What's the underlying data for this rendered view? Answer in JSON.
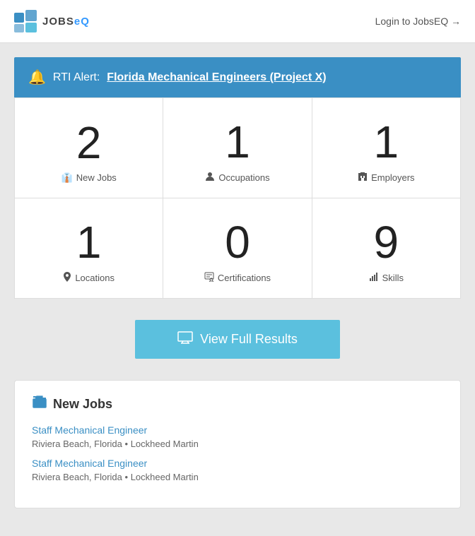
{
  "header": {
    "logo_text_jobs": "JOBS",
    "logo_text_eq": "eQ",
    "login_label": "Login to JobsEQ →"
  },
  "alert": {
    "text_prefix": "RTI Alert:",
    "link_text": "Florida Mechanical Engineers (Project X)"
  },
  "stats": [
    {
      "value": "2",
      "label": "New Jobs",
      "icon": "briefcase"
    },
    {
      "value": "1",
      "label": "Occupations",
      "icon": "person"
    },
    {
      "value": "1",
      "label": "Employers",
      "icon": "building"
    },
    {
      "value": "1",
      "label": "Locations",
      "icon": "pin"
    },
    {
      "value": "0",
      "label": "Certifications",
      "icon": "certificate"
    },
    {
      "value": "9",
      "label": "Skills",
      "icon": "skills"
    }
  ],
  "view_results_btn": "View Full Results",
  "new_jobs_section": {
    "title": "New Jobs",
    "jobs": [
      {
        "title": "Staff Mechanical Engineer",
        "location": "Riviera Beach, Florida",
        "employer": "Lockheed Martin"
      },
      {
        "title": "Staff Mechanical Engineer",
        "location": "Riviera Beach, Florida",
        "employer": "Lockheed Martin"
      }
    ]
  },
  "icons": {
    "briefcase": "🏢",
    "person": "👤",
    "building": "🏛",
    "pin": "📍",
    "certificate": "📋",
    "skills": "📊",
    "bell": "🔔",
    "screen": "🖥"
  }
}
